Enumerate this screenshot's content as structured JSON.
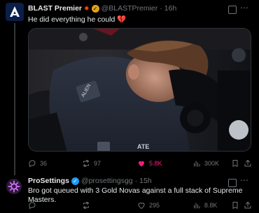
{
  "tweet1": {
    "name": "BLAST Premier",
    "handle": "@BLASTPremier",
    "separator": "·",
    "time": "16h",
    "text": "He did everything he could",
    "text_emoji": "💔",
    "replies": "36",
    "reposts": "97",
    "likes": "5.8K",
    "views": "300K",
    "more": "⋯",
    "jersey_text_1": "ALIEN",
    "jersey_text_2": "ATE"
  },
  "tweet2": {
    "name": "ProSettings",
    "handle": "@prosettingsgg",
    "separator": "·",
    "time": "15h",
    "text": "Bro got queued with 3 Gold Novas against a full stack of Supreme Masters.",
    "replies": "",
    "reposts": "",
    "likes": "295",
    "views": "8.8K",
    "more": "⋯"
  },
  "colors": {
    "background": "#000000",
    "text": "#e7e9ea",
    "muted": "#71767b",
    "like_active": "#f91880",
    "verified_blue": "#1d9bf0",
    "verified_gold": "#e0a21b"
  }
}
